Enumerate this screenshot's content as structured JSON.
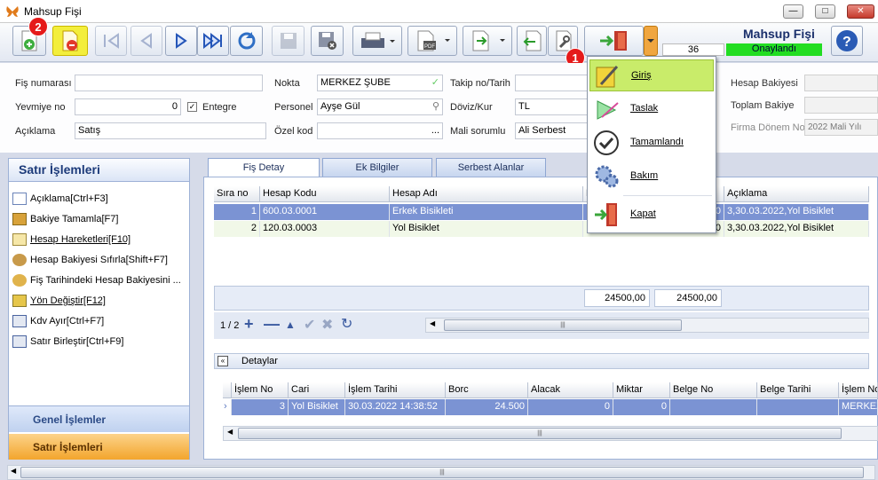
{
  "window": {
    "title": "Mahsup Fişi"
  },
  "header": {
    "title": "Mahsup Fişi",
    "number": "36",
    "status": "Onaylandı",
    "status_color": "#22dd22"
  },
  "badges": {
    "b1": "1",
    "b2": "2"
  },
  "form": {
    "fis_numarasi": {
      "label": "Fiş numarası",
      "value": ""
    },
    "yevmiye_no": {
      "label": "Yevmiye no",
      "value": "0"
    },
    "entegre": {
      "label": "Entegre",
      "checked": true
    },
    "aciklama": {
      "label": "Açıklama",
      "value": "Satış"
    },
    "nokta": {
      "label": "Nokta",
      "value": "MERKEZ ŞUBE"
    },
    "personel": {
      "label": "Personel",
      "value": "Ayşe Gül"
    },
    "ozel_kod": {
      "label": "Özel kod",
      "value": "..."
    },
    "takip_no": {
      "label": "Takip no/Tarih",
      "value": ""
    },
    "doviz": {
      "label": "Döviz/Kur",
      "value": "TL"
    },
    "mali": {
      "label": "Mali sorumlu",
      "value": "Ali Serbest"
    },
    "hesap_bakiyesi": {
      "label": "Hesap Bakiyesi"
    },
    "toplam_bakiye": {
      "label": "Toplam Bakiye"
    },
    "firma_donem": {
      "label": "Firma Dönem No",
      "value": "2022 Mali Yılı"
    }
  },
  "left": {
    "title": "Satır İşlemleri",
    "items": [
      "Açıklama[Ctrl+F3]",
      "Bakiye Tamamla[F7]",
      "Hesap Hareketleri[F10]",
      "Hesap Bakiyesi Sıfırla[Shift+F7]",
      "Fiş Tarihindeki Hesap Bakiyesini ...",
      "Yön Değiştir[F12]",
      "Kdv Ayır[Ctrl+F7]",
      "Satır Birleştir[Ctrl+F9]"
    ],
    "genel": "Genel İşlemler",
    "satir": "Satır İşlemleri"
  },
  "tabs": [
    "Fiş Detay",
    "Ek Bilgiler",
    "Serbest Alanlar"
  ],
  "grid": {
    "columns": [
      "Sıra no",
      "Hesap Kodu",
      "Hesap Adı",
      "B",
      "Açıklama"
    ],
    "rows": [
      {
        "sira": "1",
        "kod": "600.03.0001",
        "ad": "Erkek  Bisikleti",
        "b": "0",
        "aciklama": "3,30.03.2022,Yol Bisiklet"
      },
      {
        "sira": "2",
        "kod": "120.03.0003",
        "ad": "Yol Bisiklet",
        "b": "0",
        "aciklama": "3,30.03.2022,Yol Bisiklet"
      }
    ],
    "sum1": "24500,00",
    "sum2": "24500,00",
    "page": "1 / 2"
  },
  "details": {
    "title": "Detaylar",
    "columns": [
      "İşlem No",
      "Cari",
      "İşlem Tarihi",
      "Borc",
      "Alacak",
      "Miktar",
      "Belge No",
      "Belge Tarihi",
      "İşlem No"
    ],
    "row": {
      "islem": "3",
      "cari": "Yol Bisiklet",
      "tarih": "30.03.2022 14:38:52",
      "borc": "24.500",
      "alacak": "0",
      "miktar": "0",
      "belge": "",
      "btarih": "",
      "islem2": "MERKEZ"
    }
  },
  "menu": {
    "items": [
      "Giriş",
      "Taslak",
      "Tamamlandı",
      "Bakım",
      "Kapat"
    ]
  },
  "icons": [
    "butterfly-icon",
    "new-document-icon",
    "delete-document-icon",
    "first-icon",
    "prev-icon",
    "next-icon",
    "last-icon",
    "refresh-icon",
    "save-icon",
    "cancel-save-icon",
    "print-icon",
    "pdf-icon",
    "export-icon",
    "import-icon",
    "tool-icon",
    "exit-door-icon",
    "help-icon"
  ]
}
